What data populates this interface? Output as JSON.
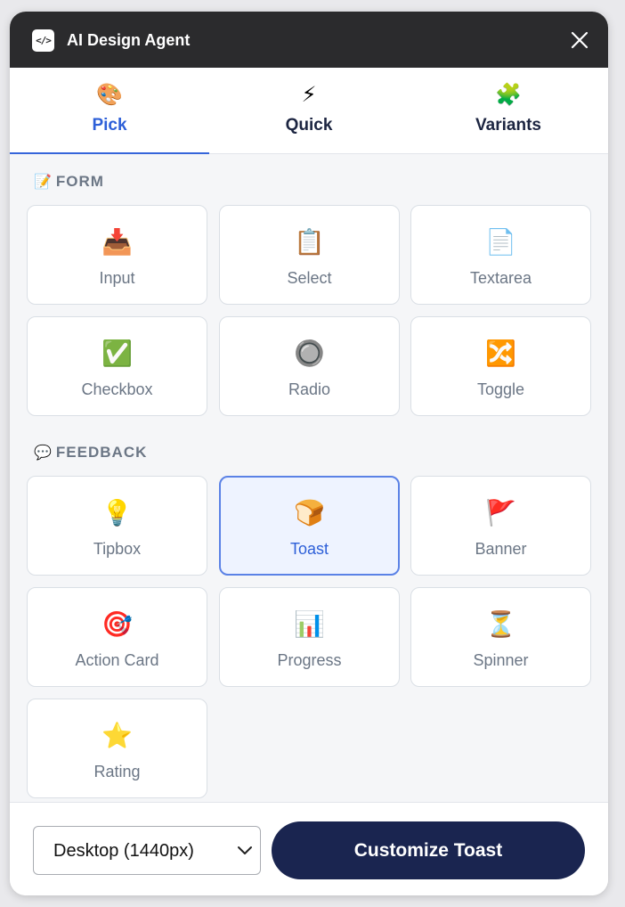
{
  "header": {
    "logo_glyph": "</>",
    "title": "AI Design Agent",
    "close_icon": "close-icon"
  },
  "tabs": [
    {
      "label": "Pick",
      "icon": "🎨",
      "icon_name": "palette-icon",
      "active": true
    },
    {
      "label": "Quick",
      "icon": "⚡",
      "icon_name": "lightning-icon",
      "active": false
    },
    {
      "label": "Variants",
      "icon": "🧩",
      "icon_name": "puzzle-icon",
      "active": false
    }
  ],
  "sections": [
    {
      "title": "FORM",
      "icon": "📝",
      "icon_name": "memo-icon",
      "items": [
        {
          "label": "Input",
          "icon": "📥",
          "icon_name": "inbox-tray-icon"
        },
        {
          "label": "Select",
          "icon": "📋",
          "icon_name": "clipboard-icon"
        },
        {
          "label": "Textarea",
          "icon": "📄",
          "icon_name": "page-icon"
        },
        {
          "label": "Checkbox",
          "icon": "✅",
          "icon_name": "checkbox-icon"
        },
        {
          "label": "Radio",
          "icon": "🔘",
          "icon_name": "radio-button-icon"
        },
        {
          "label": "Toggle",
          "icon": "🔀",
          "icon_name": "shuffle-icon"
        }
      ]
    },
    {
      "title": "FEEDBACK",
      "icon": "💬",
      "icon_name": "speech-bubble-icon",
      "items": [
        {
          "label": "Tipbox",
          "icon": "💡",
          "icon_name": "lightbulb-icon"
        },
        {
          "label": "Toast",
          "icon": "🍞",
          "icon_name": "bread-icon",
          "selected": true
        },
        {
          "label": "Banner",
          "icon": "🚩",
          "icon_name": "flag-icon"
        },
        {
          "label": "Action Card",
          "icon": "🎯",
          "icon_name": "target-icon"
        },
        {
          "label": "Progress",
          "icon": "📊",
          "icon_name": "bar-chart-icon"
        },
        {
          "label": "Spinner",
          "icon": "⏳",
          "icon_name": "hourglass-icon"
        },
        {
          "label": "Rating",
          "icon": "⭐",
          "icon_name": "star-icon"
        }
      ]
    }
  ],
  "footer": {
    "viewport_select": {
      "value": "Desktop (1440px)",
      "icon_name": "chevron-down-icon"
    },
    "cta_label": "Customize Toast"
  },
  "colors": {
    "header_bg": "#2b2b2d",
    "accent": "#3565da",
    "cta_bg": "#1a2550",
    "selected_card_bg": "#eef3ff",
    "muted_text": "#6b7685"
  }
}
